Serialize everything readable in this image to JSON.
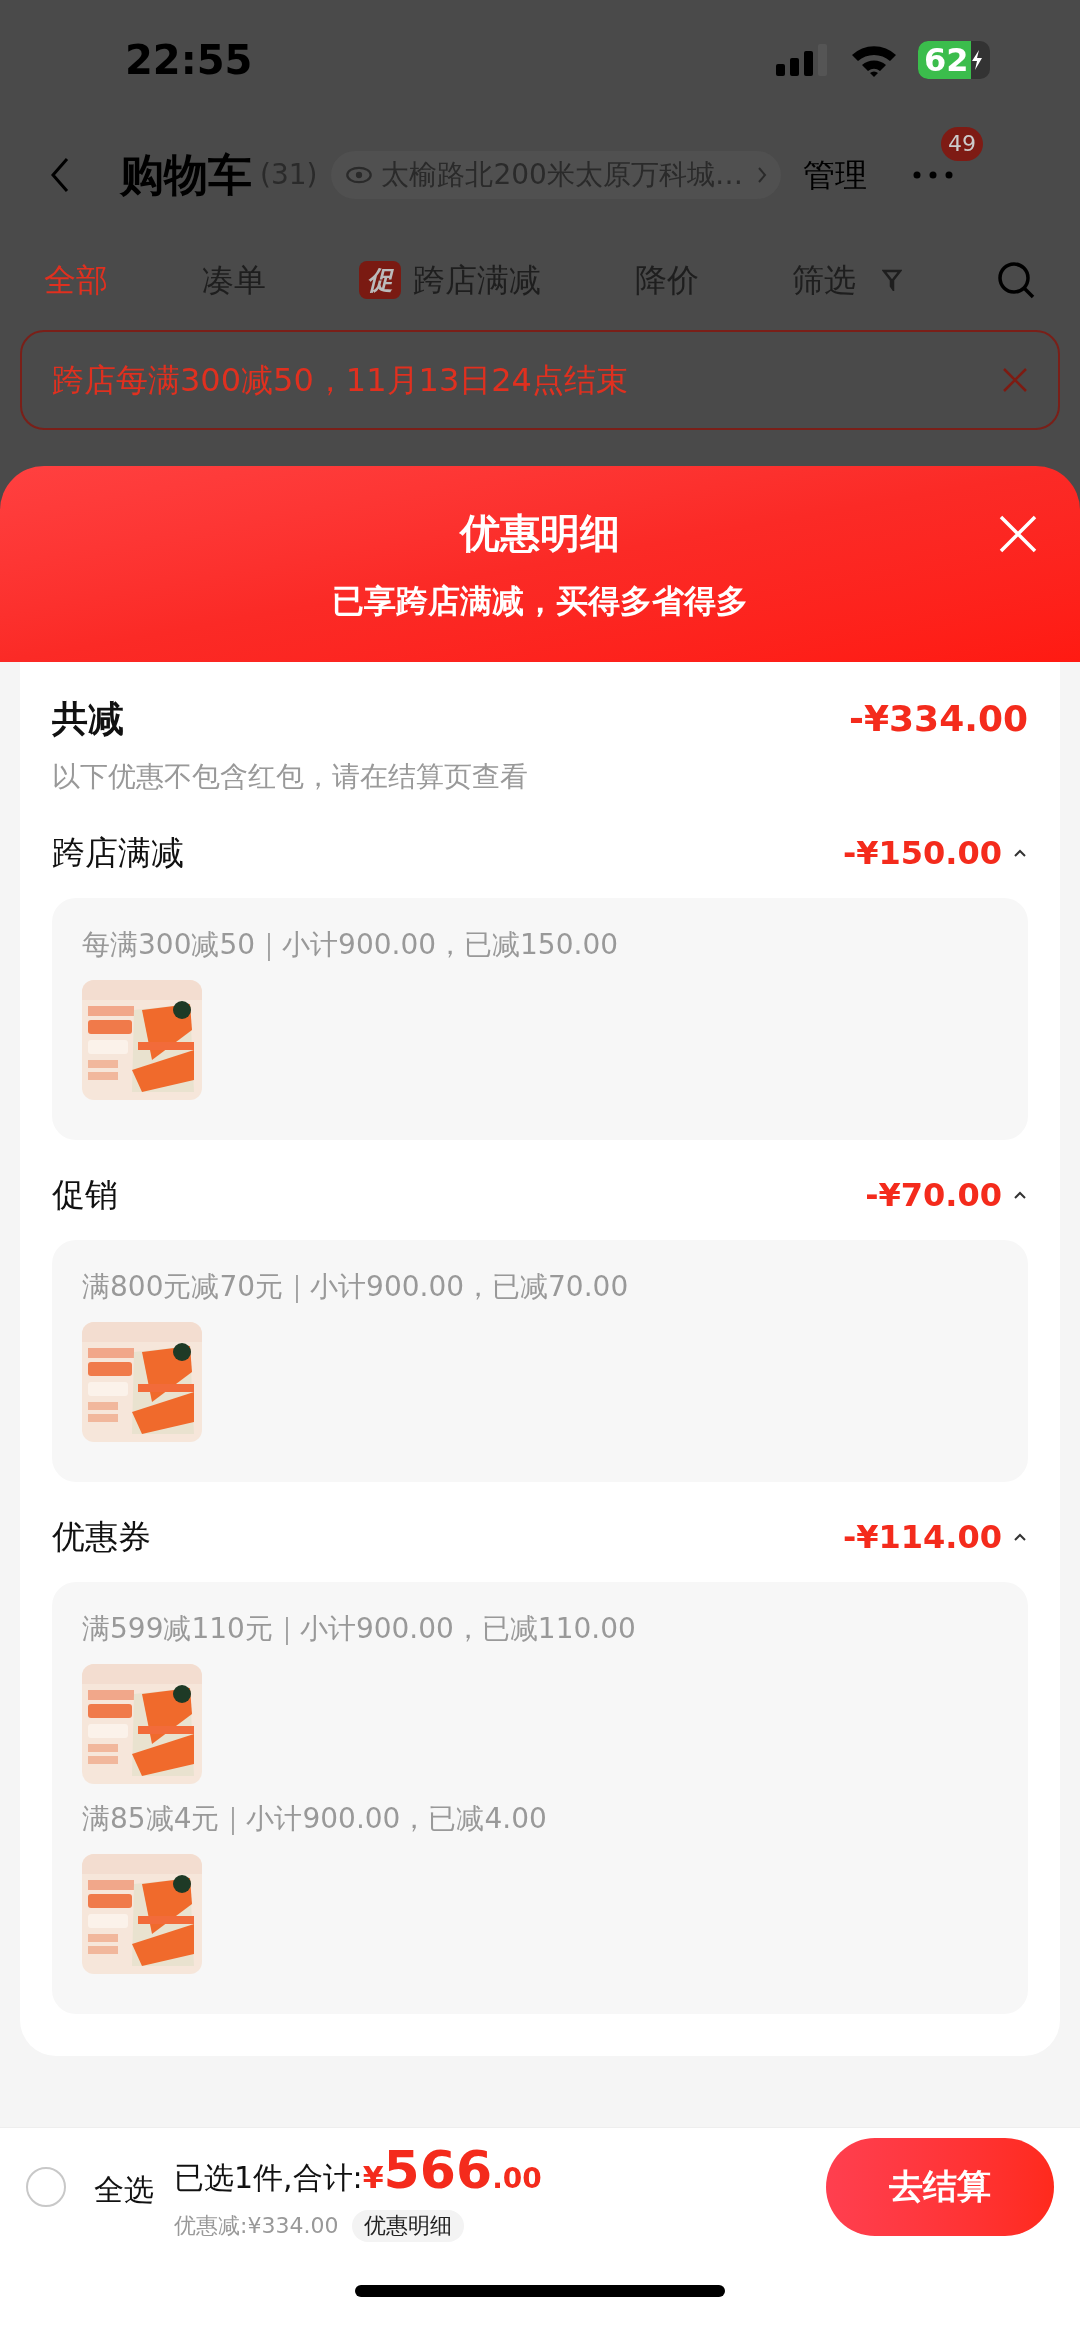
{
  "status_bar": {
    "time": "22:55",
    "battery": "62"
  },
  "nav": {
    "title": "购物车",
    "count": "(31)",
    "address": "太榆路北200米太原万科城…",
    "manage": "管理",
    "badge": "49"
  },
  "tabs": [
    {
      "label": "全部",
      "selected": true
    },
    {
      "label": "凑单",
      "selected": false
    },
    {
      "label": "跨店满减",
      "selected": false,
      "tag": "促"
    },
    {
      "label": "降价",
      "selected": false
    },
    {
      "label": "筛选",
      "selected": false,
      "kind": "filter"
    }
  ],
  "banner": {
    "text": "跨店每满300减50，11月13日24点结束"
  },
  "sheet": {
    "title": "优惠明细",
    "subtitle": "已享跨店满减，买得多省得多",
    "total": {
      "label": "共减",
      "amount": "-¥334.00",
      "note": "以下优惠不包含红包，请在结算页查看"
    },
    "sections": [
      {
        "title": "跨店满减",
        "amount": "-¥150.00",
        "expanded": true,
        "groups": [
          {
            "rule": "每满300减50｜小计900.00，已减150.00"
          }
        ]
      },
      {
        "title": "促销",
        "amount": "-¥70.00",
        "expanded": true,
        "groups": [
          {
            "rule": "满800元减70元｜小计900.00，已减70.00"
          }
        ]
      },
      {
        "title": "优惠券",
        "amount": "-¥114.00",
        "expanded": true,
        "groups": [
          {
            "rule": "满599减110元｜小计900.00，已减110.00"
          },
          {
            "rule": "满85减4元｜小计900.00，已减4.00"
          }
        ]
      }
    ]
  },
  "bottom_bar": {
    "select_all": {
      "label": "全选",
      "checked": false
    },
    "summary": "已选1件,合计:",
    "currency": "¥",
    "amount_int": "566",
    "amount_dec": ".00",
    "discount": "优惠减:¥334.00",
    "details_button": "优惠明细",
    "checkout": "去结算"
  }
}
